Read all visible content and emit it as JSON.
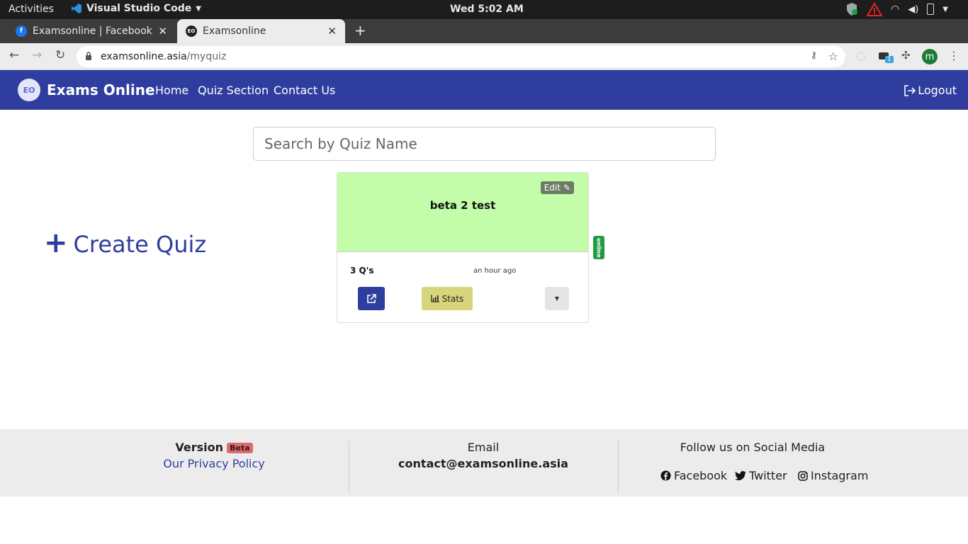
{
  "system": {
    "activities": "Activities",
    "app_name": "Visual Studio Code",
    "clock": "Wed  5:02 AM"
  },
  "browser": {
    "tabs": [
      {
        "title": "Examsonline | Facebook"
      },
      {
        "title": "Examsonline"
      }
    ],
    "url_host": "examsonline.asia",
    "url_path": "/myquiz",
    "profile_initial": "m",
    "extension_badge": "1"
  },
  "site": {
    "logo_text": "EO",
    "brand": "Exams Online",
    "nav": [
      "Home",
      "Quiz Section",
      "Contact Us"
    ],
    "logout": "Logout"
  },
  "main": {
    "search_placeholder": "Search by Quiz Name",
    "create_label": "Create Quiz",
    "quiz_card": {
      "title": "beta 2 test",
      "edit_label": "Edit",
      "question_count": "3 Q's",
      "time_ago": "an hour ago",
      "stats_label": "Stats",
      "status": "online",
      "header_color": "#c3fdaa"
    }
  },
  "footer": {
    "version_label": "Version",
    "version_badge": "Beta",
    "privacy_link": "Our Privacy Policy",
    "email_label": "Email",
    "email": "contact@examsonline.asia",
    "social_heading": "Follow us on Social Media",
    "social": [
      "Facebook",
      "Twitter",
      "Instagram"
    ]
  },
  "colors": {
    "primary": "#2f3e9e",
    "online": "#1e9c43",
    "stats": "#d7d57c",
    "beta": "#e46868"
  }
}
